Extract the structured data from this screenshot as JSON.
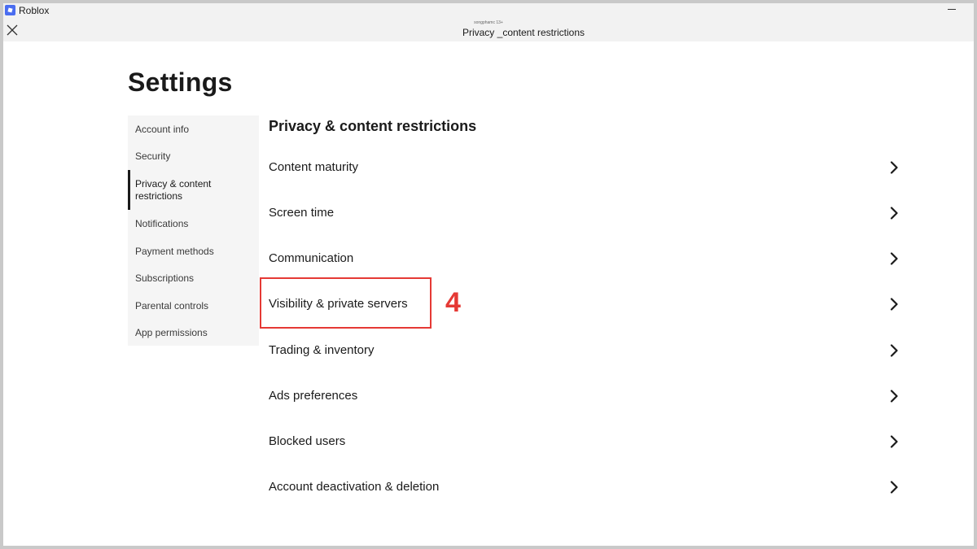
{
  "window": {
    "app_name": "Roblox",
    "small_subtitle": "songphamc 13+",
    "page_title": "Privacy _content restrictions"
  },
  "main": {
    "heading": "Settings",
    "section_title": "Privacy & content restrictions"
  },
  "sidebar": {
    "items": [
      {
        "label": "Account info"
      },
      {
        "label": "Security"
      },
      {
        "label": "Privacy & content restrictions"
      },
      {
        "label": "Notifications"
      },
      {
        "label": "Payment methods"
      },
      {
        "label": "Subscriptions"
      },
      {
        "label": "Parental controls"
      },
      {
        "label": "App permissions"
      }
    ],
    "active_index": 2
  },
  "options": [
    {
      "label": "Content maturity"
    },
    {
      "label": "Screen time"
    },
    {
      "label": "Communication"
    },
    {
      "label": "Visibility & private servers"
    },
    {
      "label": "Trading & inventory"
    },
    {
      "label": "Ads preferences"
    },
    {
      "label": "Blocked users"
    },
    {
      "label": "Account deactivation & deletion"
    }
  ],
  "annotation": {
    "step_number": "4",
    "color": "#e53935"
  },
  "icons": {
    "app": "roblox-logo-icon",
    "close": "close-icon",
    "minimize": "minimize-icon",
    "chevron": "chevron-right-icon"
  }
}
